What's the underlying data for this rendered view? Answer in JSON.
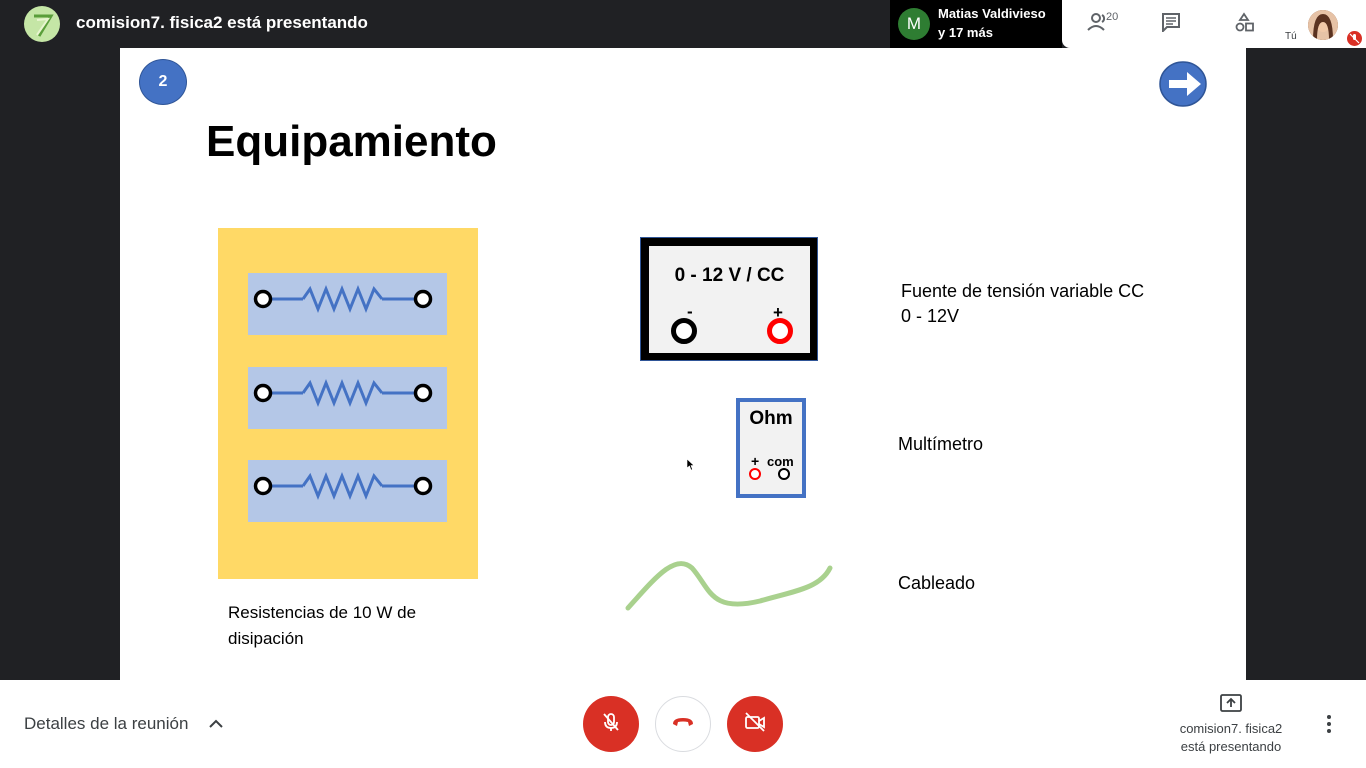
{
  "header": {
    "presenting_title": "comision7. fisica2 está presentando",
    "speaker_initial": "M",
    "speaker_name": "Matias Valdivieso",
    "speaker_more": "y 17 más",
    "participants_count": "20",
    "you_label": "Tú"
  },
  "slide": {
    "number": "2",
    "title": "Equipamiento",
    "supply_label": "0 - 12 V /  CC",
    "minus": "-",
    "plus": "+",
    "supply_desc_line1": "Fuente de tensión variable CC",
    "supply_desc_line2": "0 - 12V",
    "meter_label": "Ohm",
    "meter_plus": "+",
    "meter_com": "com",
    "meter_desc": "Multímetro",
    "cable_desc": "Cableado",
    "resist_caption_line1": "Resistencias de  10 W de",
    "resist_caption_line2": "disipación"
  },
  "footer": {
    "details_label": "Detalles de la reunión",
    "present_line1": "comision7. fisica2",
    "present_line2": "está presentando"
  },
  "colors": {
    "mic_off": "#d93025",
    "board": "#ffd966",
    "strip": "#b4c7e7",
    "resistor": "#4472c4",
    "cable": "#a9d18e"
  },
  "icons": [
    "participants-icon",
    "chat-icon",
    "activities-icon",
    "mic-off-icon",
    "hangup-icon",
    "camera-off-icon",
    "present-icon",
    "more-icon",
    "chevron-up-icon",
    "next-arrow-icon"
  ]
}
